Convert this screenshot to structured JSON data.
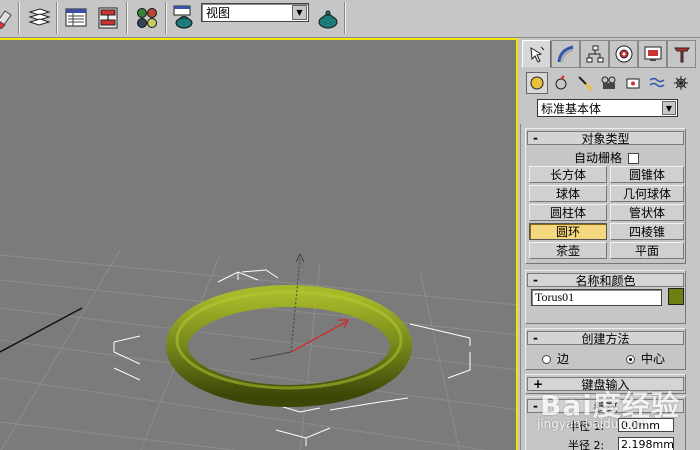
{
  "toolbar": {
    "buttons": [
      "eraser-icon",
      "layers-icon",
      "schematic-view-icon",
      "curve-editor-icon",
      "material-editor-icon",
      "render-scene-icon",
      "quick-render-icon"
    ],
    "view_dropdown": "视图"
  },
  "command_panel": {
    "tabs": [
      "create-tab",
      "modify-tab",
      "hierarchy-tab",
      "motion-tab",
      "display-tab",
      "utilities-tab"
    ],
    "subtabs": [
      "geometry-icon",
      "shapes-icon",
      "lights-icon",
      "cameras-icon",
      "helpers-icon",
      "space-warps-icon",
      "systems-icon"
    ],
    "category_dropdown": "标准基本体",
    "object_type": {
      "title": "对象类型",
      "autogrid_label": "自动栅格",
      "buttons": [
        "长方体",
        "圆锥体",
        "球体",
        "几何球体",
        "圆柱体",
        "管状体",
        "圆环",
        "四棱锥",
        "茶壶",
        "平面"
      ],
      "active_button": "圆环"
    },
    "name_color": {
      "title": "名称和颜色",
      "name_value": "Torus01",
      "color": "#6e7f12"
    },
    "creation_method": {
      "title": "创建方法",
      "options": [
        "边",
        "中心"
      ],
      "selected": "中心"
    },
    "keyboard_entry": {
      "title": "键盘输入"
    },
    "parameters": {
      "title": "参数",
      "radius1_label": "半径 1:",
      "radius1_value": "0.0mm",
      "radius2_label": "半径 2:",
      "radius2_value": "2.198mm"
    }
  },
  "watermark": {
    "text": "Bai度经验",
    "url": "jingyan.baidu.com"
  }
}
